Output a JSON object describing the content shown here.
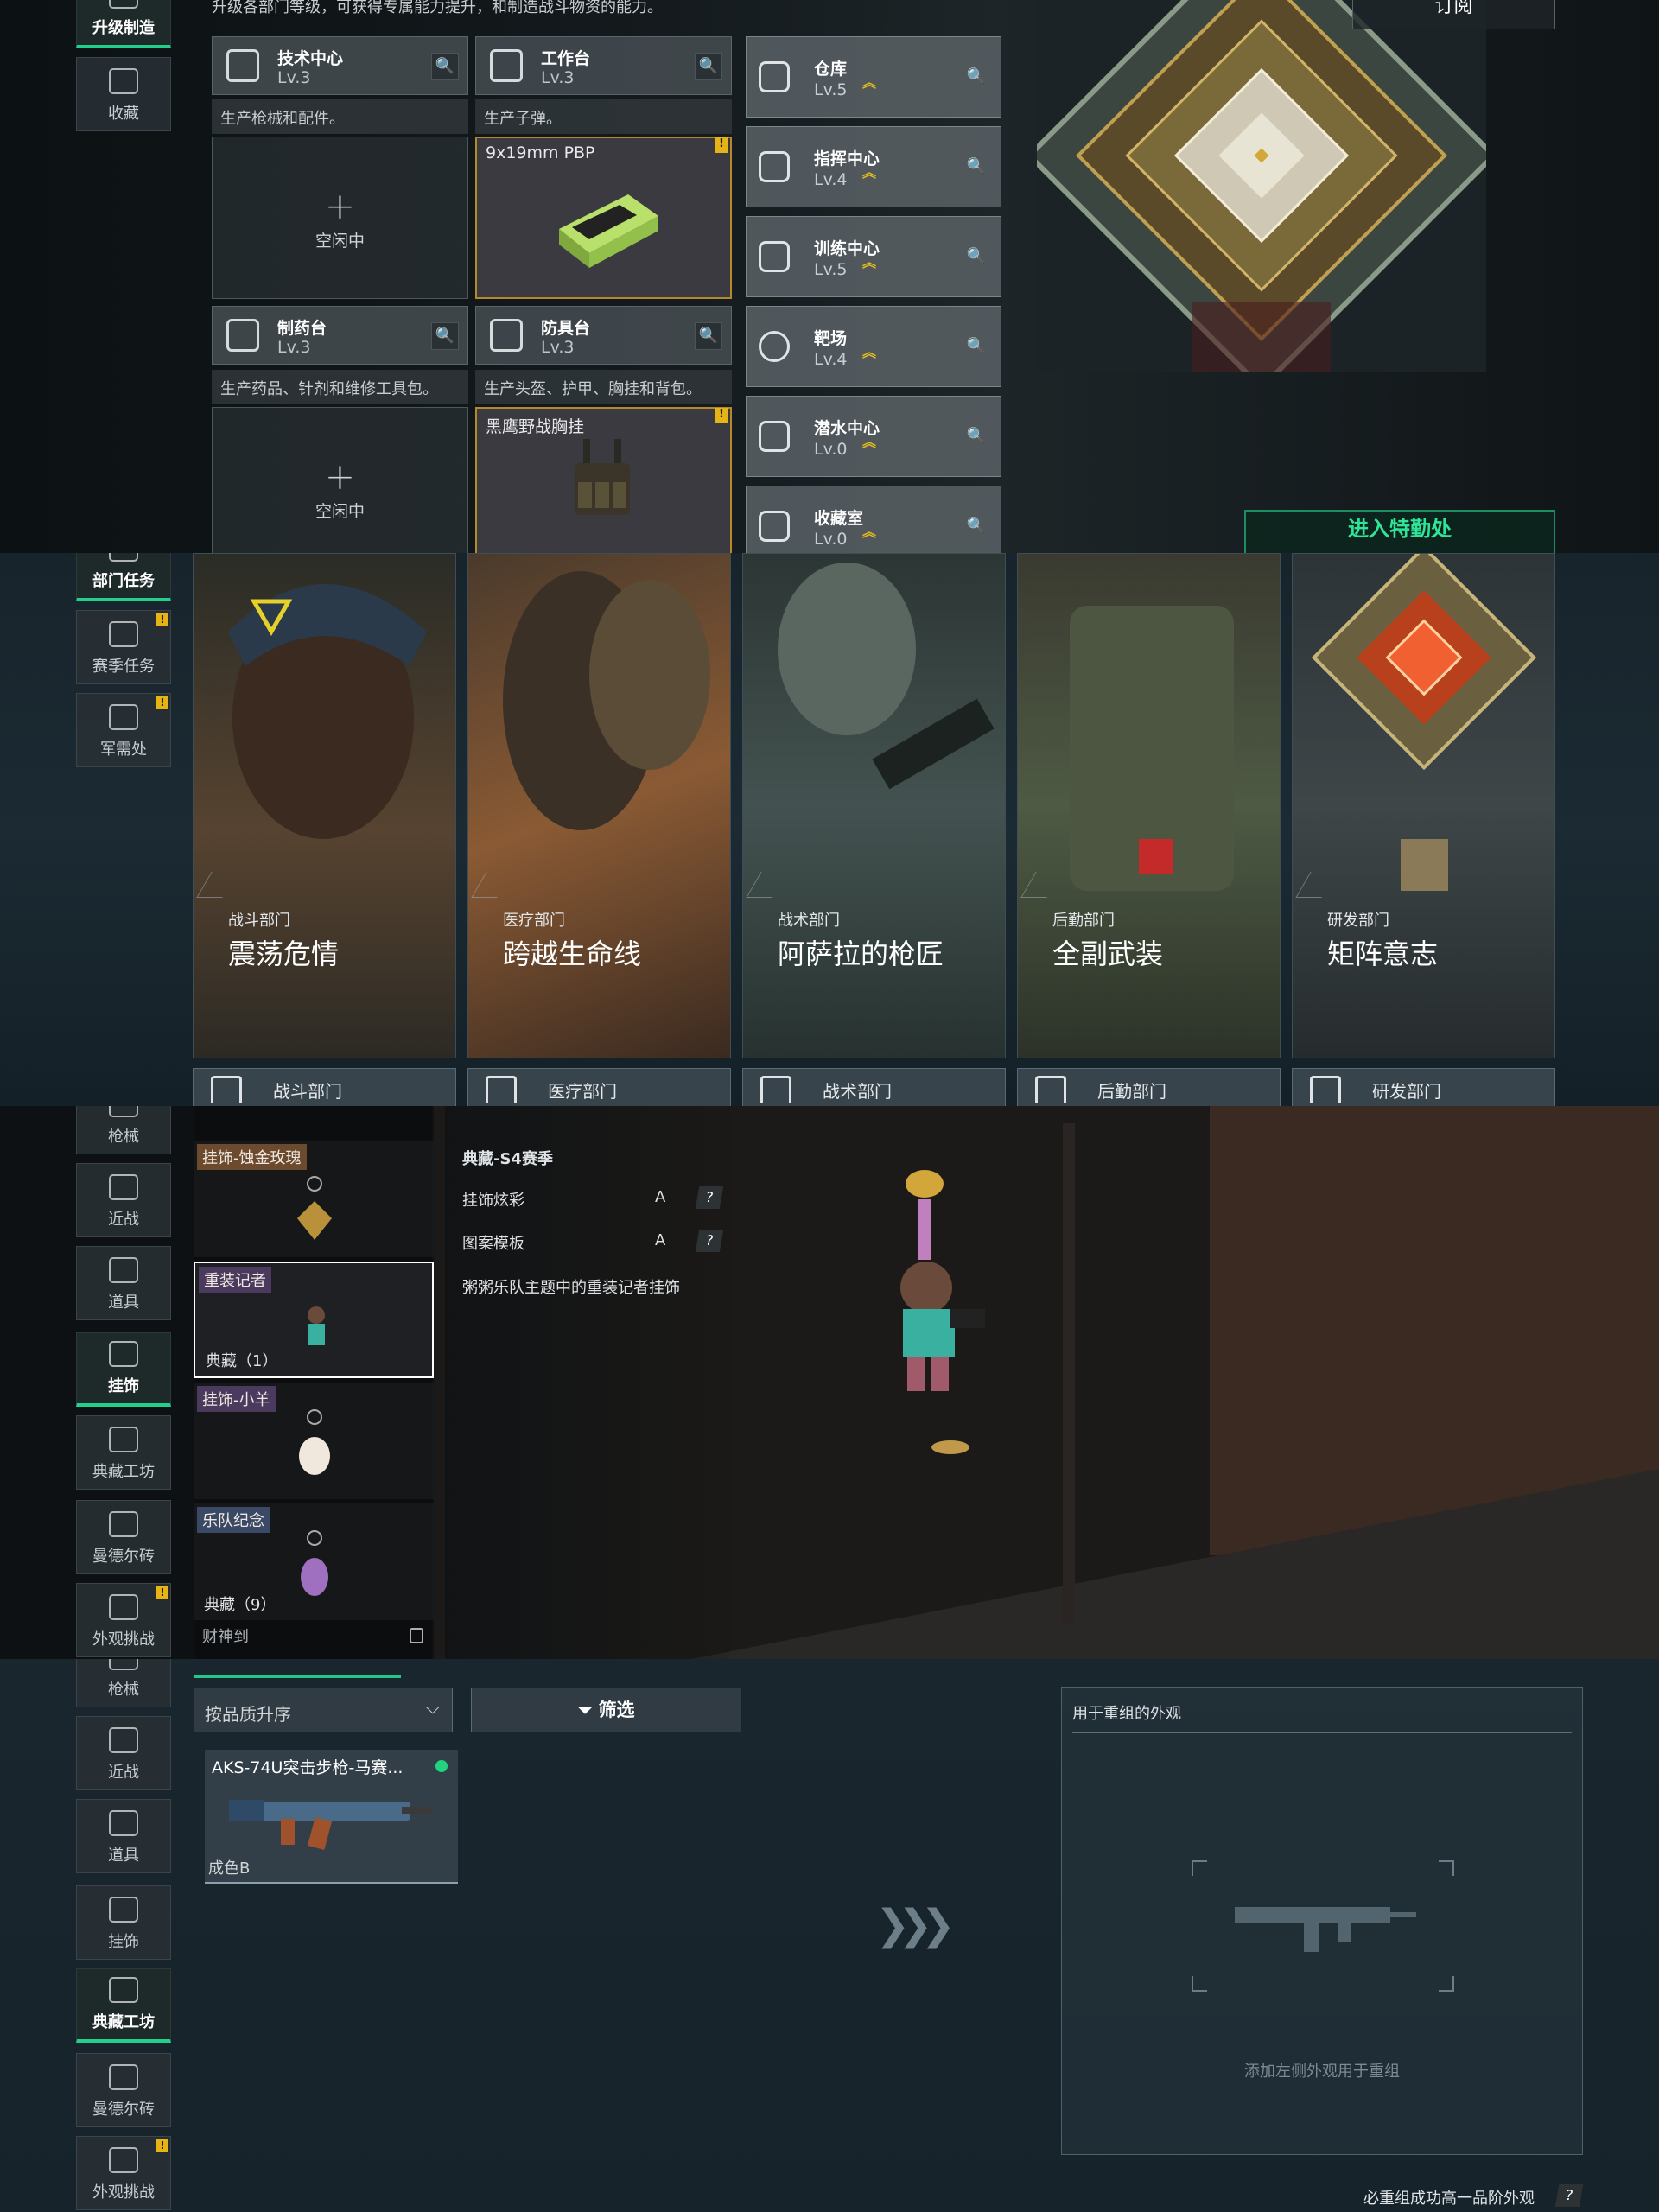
{
  "panel1": {
    "intro": "升级各部门等级，可获得专属能力提升，和制造战斗物资的能力。",
    "nav": [
      {
        "label": "升级制造",
        "active": true
      },
      {
        "label": "收藏",
        "active": false
      }
    ],
    "subscribe": "订阅",
    "enter": "进入特勤处",
    "workbenches": [
      {
        "title": "技术中心",
        "level": "Lv.3",
        "desc": "生产枪械和配件。",
        "slot_state": "空闲中",
        "plus": "+"
      },
      {
        "title": "工作台",
        "level": "Lv.3",
        "desc": "生产子弹。",
        "product": "9x19mm PBP",
        "warn": "!"
      },
      {
        "title": "制药台",
        "level": "Lv.3",
        "desc": "生产药品、针剂和维修工具包。",
        "slot_state": "空闲中",
        "plus": "+"
      },
      {
        "title": "防具台",
        "level": "Lv.3",
        "desc": "生产头盔、护甲、胸挂和背包。",
        "product": "黑鹰野战胸挂",
        "warn": "!"
      }
    ],
    "facilities": [
      {
        "title": "仓库",
        "level": "Lv.5"
      },
      {
        "title": "指挥中心",
        "level": "Lv.4"
      },
      {
        "title": "训练中心",
        "level": "Lv.5"
      },
      {
        "title": "靶场",
        "level": "Lv.4"
      },
      {
        "title": "潜水中心",
        "level": "Lv.0"
      },
      {
        "title": "收藏室",
        "level": "Lv.0"
      }
    ],
    "search_glyph": "🔍",
    "up_glyph": "︽"
  },
  "panel2": {
    "nav": [
      {
        "label": "部门任务",
        "active": true
      },
      {
        "label": "赛季任务",
        "badge": "!"
      },
      {
        "label": "军需处",
        "badge": "!"
      }
    ],
    "departments": [
      {
        "dept": "战斗部门",
        "title": "震荡危情",
        "footer": "战斗部门"
      },
      {
        "dept": "医疗部门",
        "title": "跨越生命线",
        "footer": "医疗部门"
      },
      {
        "dept": "战术部门",
        "title": "阿萨拉的枪匠",
        "footer": "战术部门"
      },
      {
        "dept": "后勤部门",
        "title": "全副武装",
        "footer": "后勤部门"
      },
      {
        "dept": "研发部门",
        "title": "矩阵意志",
        "footer": "研发部门"
      }
    ]
  },
  "panel3": {
    "nav": [
      {
        "label": "枪械"
      },
      {
        "label": "近战"
      },
      {
        "label": "道具"
      },
      {
        "label": "挂饰",
        "active": true
      },
      {
        "label": "典藏工坊"
      },
      {
        "label": "曼德尔砖"
      },
      {
        "label": "外观挑战",
        "badge": "!"
      }
    ],
    "charms": [
      {
        "tag": "挂饰-蚀金玫瑰",
        "tag_color": "#6b4a2e"
      },
      {
        "tag": "重装记者",
        "tag_color": "#4a3a5e",
        "count": "典藏（1）",
        "selected": true
      },
      {
        "tag": "挂饰-小羊",
        "tag_color": "#4a3a5e"
      },
      {
        "tag": "乐队纪念",
        "tag_color": "#3a4a66",
        "count": "典藏（9）"
      }
    ],
    "details": {
      "season": "典藏-S4赛季",
      "rows": [
        {
          "label": "挂饰炫彩",
          "value": "A",
          "q": "?"
        },
        {
          "label": "图案模板",
          "value": "A",
          "q": "?"
        }
      ],
      "description": "粥粥乐队主题中的重装记者挂饰"
    },
    "fortune": "财神到"
  },
  "panel4": {
    "nav": [
      {
        "label": "枪械"
      },
      {
        "label": "近战"
      },
      {
        "label": "道具"
      },
      {
        "label": "挂饰"
      },
      {
        "label": "典藏工坊",
        "active": true
      },
      {
        "label": "曼德尔砖"
      },
      {
        "label": "外观挑战",
        "badge": "!"
      }
    ],
    "sort_label": "按品质升序",
    "filter_label": "筛选",
    "item": {
      "name": "AKS-74U突击步枪-马赛...",
      "grade": "成色B"
    },
    "recompose_title": "用于重组的外观",
    "recompose_hint": "添加左侧外观用于重组",
    "arrows": "❯❯❯",
    "must_recompose": "必重组成功高一品阶外观",
    "q": "?"
  }
}
